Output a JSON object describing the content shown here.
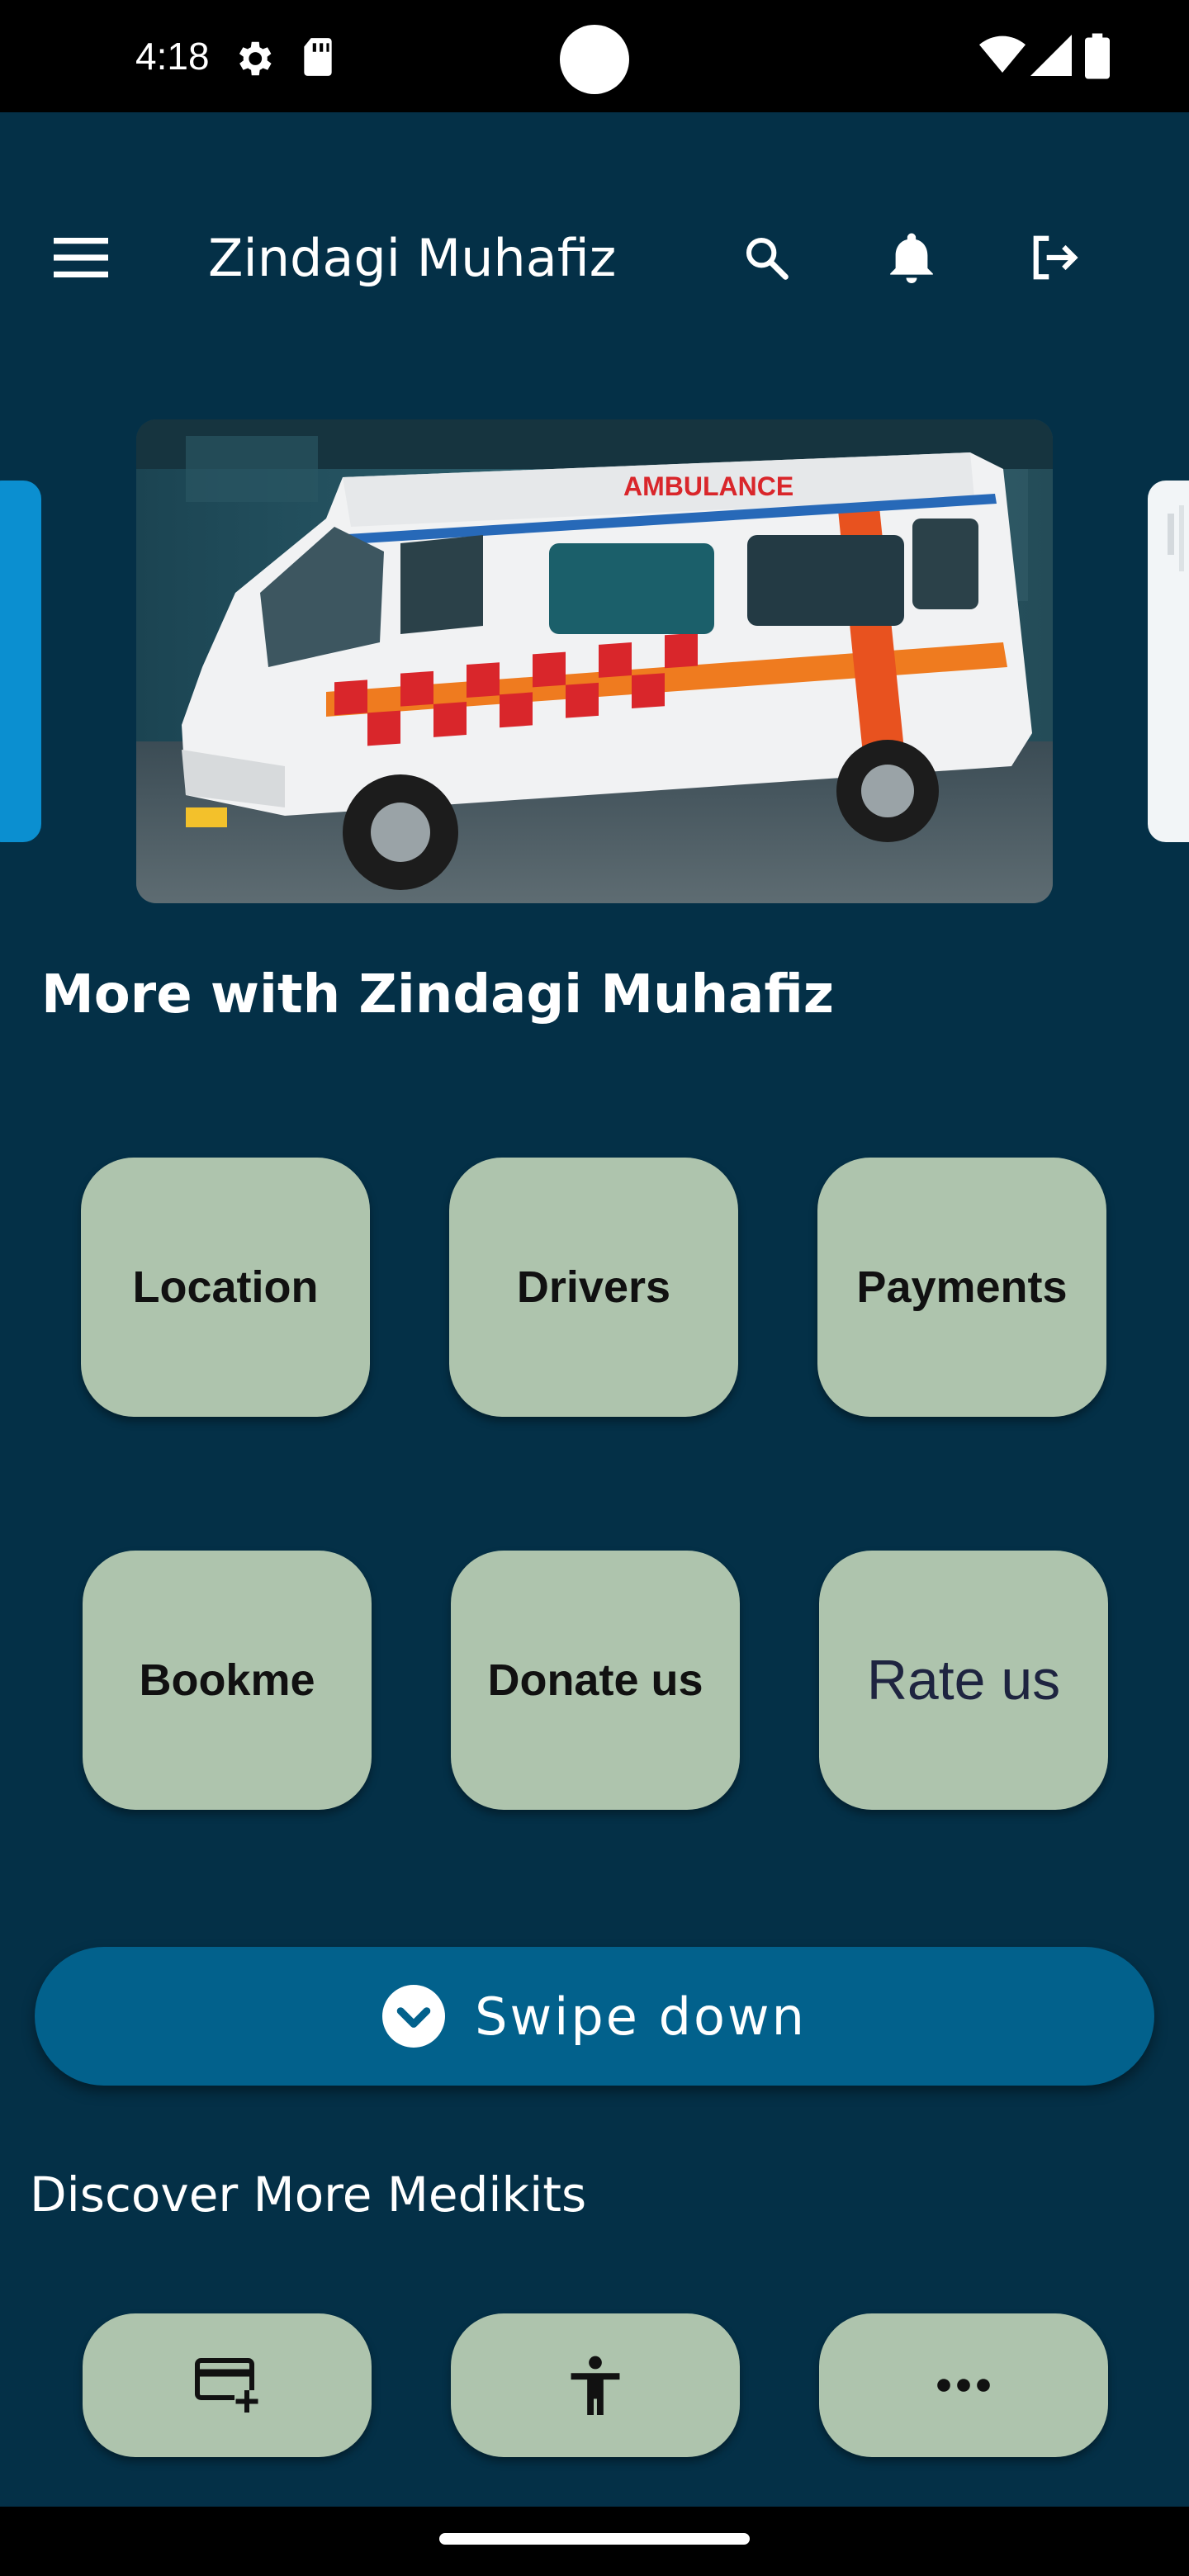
{
  "status_bar": {
    "time": "4:18",
    "icons": [
      "settings-gear-icon",
      "sd-card-icon",
      "wifi-icon",
      "cellular-signal-icon",
      "battery-icon"
    ]
  },
  "app_bar": {
    "title": "Zindagi Muhafiz",
    "menu_icon": "menu-icon",
    "search_icon": "search-icon",
    "notification_icon": "bell-icon",
    "logout_icon": "logout-icon"
  },
  "carousel": {
    "main_image": "ambulance-photo",
    "ambulance_sign": "AMBULANCE"
  },
  "section_title": "More with Zindagi Muhafiz",
  "tiles": [
    {
      "label": "Location"
    },
    {
      "label": "Drivers"
    },
    {
      "label": "Payments"
    },
    {
      "label": "Bookme"
    },
    {
      "label": "Donate us"
    },
    {
      "label": "Rate us"
    }
  ],
  "swipe": {
    "label": "Swipe down",
    "icon": "chevron-down-circle-icon"
  },
  "discover": {
    "title": "Discover More Medikits",
    "kits": [
      {
        "icon": "add-card-icon"
      },
      {
        "icon": "accessibility-icon"
      },
      {
        "icon": "more-horizontal-icon"
      }
    ]
  },
  "colors": {
    "background": "#043047",
    "tile": "#aec4ad",
    "swipe_button": "#02618c",
    "status_bar": "#000000"
  }
}
